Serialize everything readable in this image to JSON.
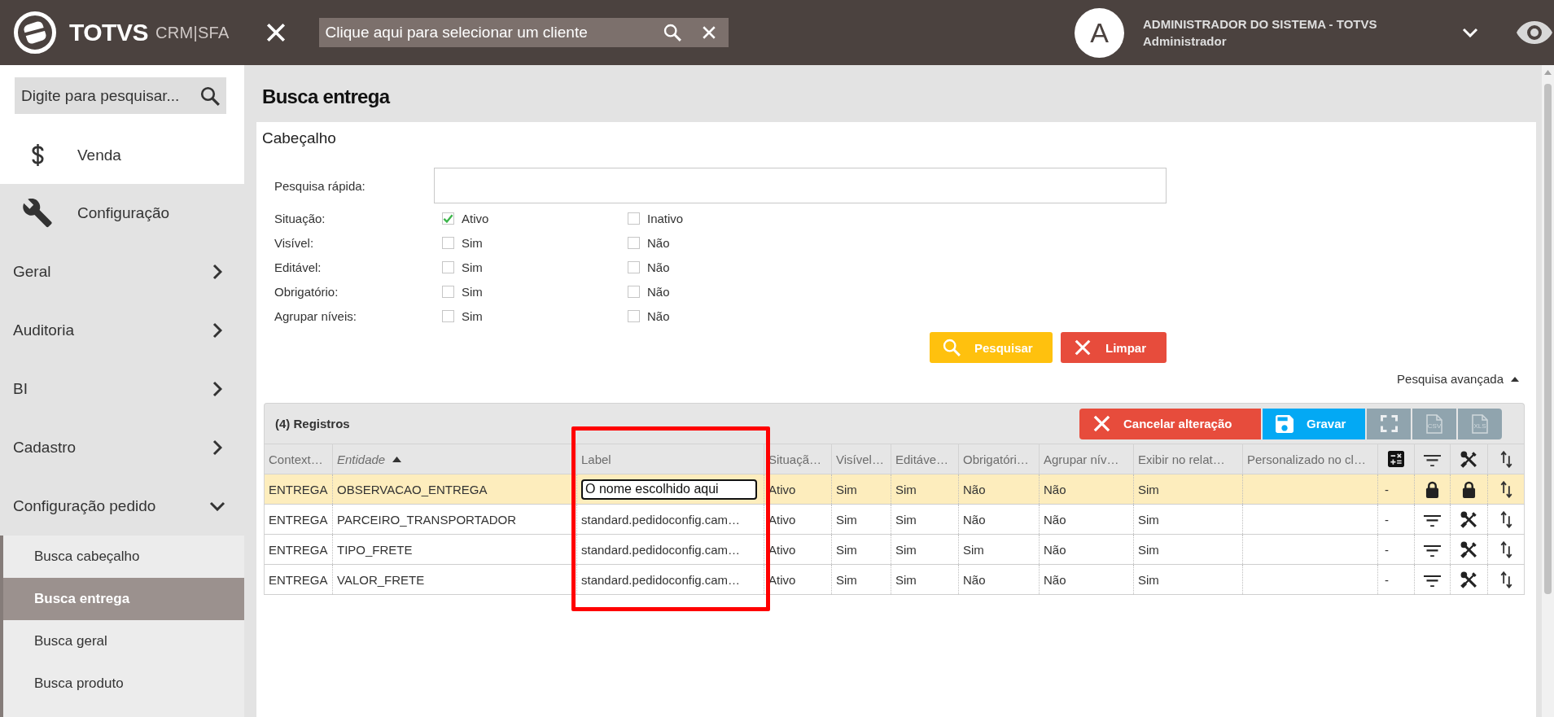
{
  "topbar": {
    "brand": "TOTVS",
    "product": "CRM|SFA",
    "client_search": {
      "placeholder": "Clique aqui para selecionar um cliente"
    },
    "user": {
      "initial": "A",
      "name": "ADMINISTRADOR DO SISTEMA - TOTVS",
      "role": "Administrador"
    }
  },
  "sidebar": {
    "search": {
      "placeholder": "Digite para pesquisar..."
    },
    "modules": [
      {
        "label": "Venda",
        "selected": false
      },
      {
        "label": "Configuração",
        "selected": true
      }
    ],
    "items": [
      {
        "label": "Geral",
        "expanded": false
      },
      {
        "label": "Auditoria",
        "expanded": false
      },
      {
        "label": "BI",
        "expanded": false
      },
      {
        "label": "Cadastro",
        "expanded": false
      },
      {
        "label": "Configuração pedido",
        "expanded": true,
        "children": [
          {
            "label": "Busca cabeçalho",
            "selected": false
          },
          {
            "label": "Busca entrega",
            "selected": true
          },
          {
            "label": "Busca geral",
            "selected": false
          },
          {
            "label": "Busca produto",
            "selected": false
          }
        ]
      }
    ]
  },
  "page": {
    "title": "Busca entrega"
  },
  "form": {
    "title": "Cabeçalho",
    "quick_search": {
      "label": "Pesquisa rápida:"
    },
    "filters": [
      {
        "label": "Situação:",
        "options": [
          {
            "label": "Ativo",
            "checked": true
          },
          {
            "label": "Inativo",
            "checked": false
          }
        ]
      },
      {
        "label": "Visível:",
        "options": [
          {
            "label": "Sim",
            "checked": false
          },
          {
            "label": "Não",
            "checked": false
          }
        ]
      },
      {
        "label": "Editável:",
        "options": [
          {
            "label": "Sim",
            "checked": false
          },
          {
            "label": "Não",
            "checked": false
          }
        ]
      },
      {
        "label": "Obrigatório:",
        "options": [
          {
            "label": "Sim",
            "checked": false
          },
          {
            "label": "Não",
            "checked": false
          }
        ]
      },
      {
        "label": "Agrupar níveis:",
        "options": [
          {
            "label": "Sim",
            "checked": false
          },
          {
            "label": "Não",
            "checked": false
          }
        ]
      }
    ],
    "buttons": [
      {
        "kind": "search",
        "label": "Pesquisar"
      },
      {
        "kind": "clear",
        "label": "Limpar"
      }
    ],
    "advanced_search": {
      "label": "Pesquisa avançada"
    }
  },
  "grid": {
    "title": "(4) Registros",
    "toolbar": [
      {
        "kind": "cancel",
        "label": "Cancelar alteração"
      },
      {
        "kind": "save",
        "label": "Gravar"
      },
      {
        "kind": "fullscreen"
      },
      {
        "kind": "export",
        "label": "CSV"
      },
      {
        "kind": "export",
        "label": "XLS"
      }
    ],
    "columns": [
      {
        "kind": "text",
        "label": "Context…",
        "sorted": false,
        "highlighted": false
      },
      {
        "kind": "text",
        "label": "Entidade",
        "sorted": true,
        "highlighted": false
      },
      {
        "kind": "text",
        "label": "Label",
        "sorted": false,
        "highlighted": true
      },
      {
        "kind": "text",
        "label": "Situaçã…",
        "sorted": false,
        "highlighted": false
      },
      {
        "kind": "text",
        "label": "Visível…",
        "sorted": false,
        "highlighted": false
      },
      {
        "kind": "text",
        "label": "Editáve…",
        "sorted": false,
        "highlighted": false
      },
      {
        "kind": "text",
        "label": "Obrigatóri…",
        "sorted": false,
        "highlighted": false
      },
      {
        "kind": "text",
        "label": "Agrupar nív…",
        "sorted": false,
        "highlighted": false
      },
      {
        "kind": "text",
        "label": "Exibir no relat…",
        "sorted": false,
        "highlighted": false
      },
      {
        "kind": "text",
        "label": "Personalizado no cl…",
        "sorted": false,
        "highlighted": false
      },
      {
        "kind": "icon",
        "sorted": false,
        "highlighted": false
      },
      {
        "kind": "icon",
        "sorted": false,
        "highlighted": false
      },
      {
        "kind": "icon",
        "sorted": false,
        "highlighted": false
      },
      {
        "kind": "icon",
        "sorted": false,
        "highlighted": false
      }
    ],
    "rows": [
      {
        "selected": true,
        "editing": true,
        "locked": true,
        "context": "ENTREGA",
        "entity": "OBSERVACAO_ENTREGA",
        "label": "O nome escolhido aqui",
        "situation": "Ativo",
        "visible": "Sim",
        "editable": "Sim",
        "required": "Não",
        "group_levels": "Não",
        "show_in_report": "Sim",
        "calc": "-"
      },
      {
        "selected": false,
        "editing": false,
        "locked": false,
        "context": "ENTREGA",
        "entity": "PARCEIRO_TRANSPORTADOR",
        "label": "standard.pedidoconfig.cam…",
        "situation": "Ativo",
        "visible": "Sim",
        "editable": "Sim",
        "required": "Não",
        "group_levels": "Não",
        "show_in_report": "Sim",
        "calc": "-"
      },
      {
        "selected": false,
        "editing": false,
        "locked": false,
        "context": "ENTREGA",
        "entity": "TIPO_FRETE",
        "label": "standard.pedidoconfig.cam…",
        "situation": "Ativo",
        "visible": "Sim",
        "editable": "Sim",
        "required": "Sim",
        "group_levels": "Não",
        "show_in_report": "Sim",
        "calc": "-"
      },
      {
        "selected": false,
        "editing": false,
        "locked": false,
        "context": "ENTREGA",
        "entity": "VALOR_FRETE",
        "label": "standard.pedidoconfig.cam…",
        "situation": "Ativo",
        "visible": "Sim",
        "editable": "Sim",
        "required": "Não",
        "group_levels": "Não",
        "show_in_report": "Sim",
        "calc": "-"
      }
    ]
  }
}
